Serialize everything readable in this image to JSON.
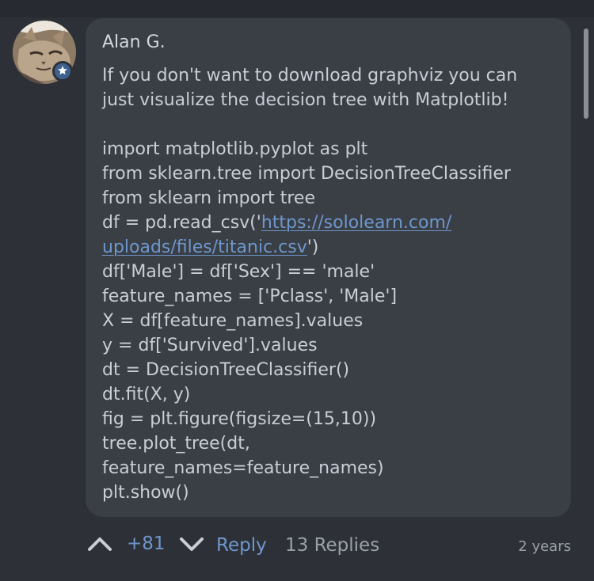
{
  "comment": {
    "author": "Alan G.",
    "avatar_icon": "cat-photo-avatar",
    "badge_icon": "star-icon",
    "intro_lines": [
      "If you don't want to download graphviz you can",
      "just visualize the decision tree with Matplotlib!"
    ],
    "code_lines": [
      "import matplotlib.pyplot as plt",
      "from sklearn.tree import DecisionTreeClassifier",
      "from sklearn import tree"
    ],
    "read_csv_prefix": "df = pd.read_csv('",
    "link_part1": "https://sololearn.com/",
    "link_part2": "uploads/files/titanic.csv",
    "read_csv_suffix": "')",
    "code_lines_after": [
      "df['Male'] = df['Sex'] == 'male'",
      "feature_names = ['Pclass', 'Male']",
      "X = df[feature_names].values",
      "y = df['Survived'].values",
      "dt = DecisionTreeClassifier()",
      "dt.fit(X, y)",
      "fig = plt.figure(figsize=(15,10))",
      "tree.plot_tree(dt,",
      "feature_names=feature_names)",
      "plt.show()"
    ]
  },
  "footer": {
    "upvote_icon": "chevron-up-icon",
    "votes": "+81",
    "downvote_icon": "chevron-down-icon",
    "reply_label": "Reply",
    "replies_label": "13 Replies",
    "time_ago": "2 years"
  },
  "colors": {
    "background": "#2d3137",
    "bubble": "#3a3e45",
    "accent": "#6e97cc",
    "text": "#c9ced6",
    "muted": "#9aa0a8"
  }
}
